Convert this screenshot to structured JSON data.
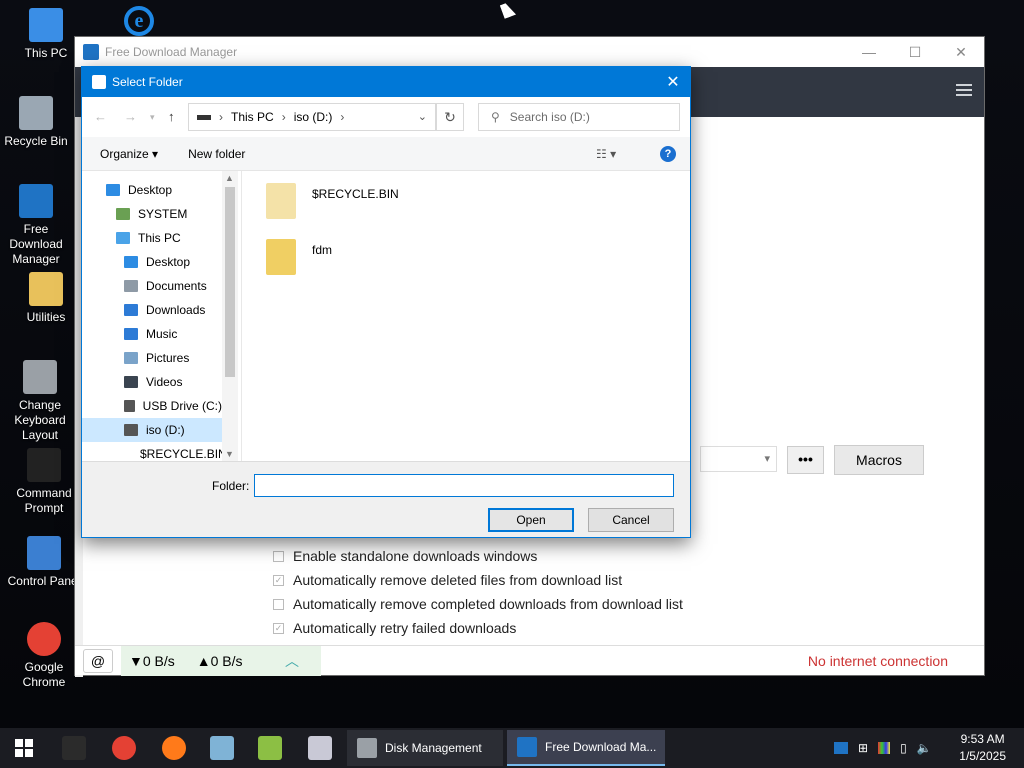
{
  "desktop": {
    "icons": [
      {
        "label": "This PC",
        "icon": "computer-icon",
        "color": "#3a8ee6"
      },
      {
        "label": "Recycle Bin",
        "icon": "recycle-bin-icon",
        "color": "#9aa7b3"
      },
      {
        "label": "Free Download Manager",
        "icon": "fdm-icon",
        "color": "#1f73c4"
      },
      {
        "label": "Utilities",
        "icon": "folder-icon",
        "color": "#e8c15b"
      },
      {
        "label": "Change Keyboard Layout",
        "icon": "keyboard-settings-icon",
        "color": "#9aa0a6"
      },
      {
        "label": "Command Prompt",
        "icon": "cmd-icon",
        "color": "#222222"
      },
      {
        "label": "Control Panel",
        "icon": "control-panel-icon",
        "color": "#3b7fd1"
      },
      {
        "label": "Google Chrome",
        "icon": "chrome-icon",
        "color": "#e44134"
      }
    ],
    "ie_icon": "internet-explorer-icon"
  },
  "fdm_window": {
    "title": "Free Download Manager",
    "macros_label": "Macros",
    "dots_label": "•••",
    "options": [
      {
        "label": "Enable standalone downloads windows",
        "checked": false
      },
      {
        "label": "Automatically remove deleted files from download list",
        "checked": true
      },
      {
        "label": "Automatically remove completed downloads from download list",
        "checked": false
      },
      {
        "label": "Automatically retry failed downloads",
        "checked": true
      }
    ],
    "status": {
      "download_speed": "▼0 B/s",
      "upload_speed": "▲0 B/s",
      "connection": "No internet connection"
    }
  },
  "dialog": {
    "title": "Select Folder",
    "address": {
      "segments": [
        "This PC",
        "iso (D:)"
      ]
    },
    "search_placeholder": "Search iso (D:)",
    "organize_label": "Organize ▾",
    "new_folder_label": "New folder",
    "tree": [
      {
        "label": "Desktop",
        "icon": "desktop-icon",
        "color": "#2d8ce3",
        "indent": 0,
        "selected": false
      },
      {
        "label": "SYSTEM",
        "icon": "user-icon",
        "color": "#6aa053",
        "indent": 1,
        "selected": false
      },
      {
        "label": "This PC",
        "icon": "computer-icon",
        "color": "#4aa3e8",
        "indent": 1,
        "selected": false
      },
      {
        "label": "Desktop",
        "icon": "desktop-icon",
        "color": "#2d8ce3",
        "indent": 2,
        "selected": false
      },
      {
        "label": "Documents",
        "icon": "documents-icon",
        "color": "#8e9aa6",
        "indent": 2,
        "selected": false
      },
      {
        "label": "Downloads",
        "icon": "downloads-icon",
        "color": "#2d7bd6",
        "indent": 2,
        "selected": false
      },
      {
        "label": "Music",
        "icon": "music-icon",
        "color": "#2d7bd6",
        "indent": 2,
        "selected": false
      },
      {
        "label": "Pictures",
        "icon": "pictures-icon",
        "color": "#7aa3c9",
        "indent": 2,
        "selected": false
      },
      {
        "label": "Videos",
        "icon": "videos-icon",
        "color": "#3a4450",
        "indent": 2,
        "selected": false
      },
      {
        "label": "USB Drive (C:)",
        "icon": "drive-icon",
        "color": "#555555",
        "indent": 2,
        "selected": false
      },
      {
        "label": "iso (D:)",
        "icon": "drive-icon",
        "color": "#555555",
        "indent": 2,
        "selected": true
      },
      {
        "label": "$RECYCLE.BIN",
        "icon": "folder-icon",
        "color": "#f1da95",
        "indent": 3,
        "selected": false
      }
    ],
    "files": [
      {
        "name": "$RECYCLE.BIN",
        "icon": "folder-icon",
        "color": "#f4e2a8"
      },
      {
        "name": "fdm",
        "icon": "fdm-folder-icon",
        "color": "#f0cf63"
      }
    ],
    "folder_label": "Folder:",
    "folder_value": "",
    "open_label": "Open",
    "cancel_label": "Cancel",
    "help_label": "?"
  },
  "taskbar": {
    "pinned": [
      {
        "icon": "cmd-icon",
        "color": "#2b2b2b"
      },
      {
        "icon": "chrome-icon",
        "color": "#e44134"
      },
      {
        "icon": "firefox-icon",
        "color": "#ff7a1a"
      },
      {
        "icon": "notepad-icon",
        "color": "#7fb3d6"
      },
      {
        "icon": "chart-app-icon",
        "color": "#8cbf44"
      },
      {
        "icon": "paint-icon",
        "color": "#c9c9d6"
      }
    ],
    "tasks": [
      {
        "label": "Disk Management",
        "icon": "disk-management-icon",
        "color": "#9aa0a6",
        "active": false
      },
      {
        "label": "Free Download Ma...",
        "icon": "fdm-icon",
        "color": "#1f73c4",
        "active": true
      }
    ],
    "time": "9:53 AM",
    "date": "1/5/2025"
  },
  "colors": {
    "accent": "#0078d7",
    "fdm_toolbar": "#313742",
    "error_text": "#cc3333"
  }
}
